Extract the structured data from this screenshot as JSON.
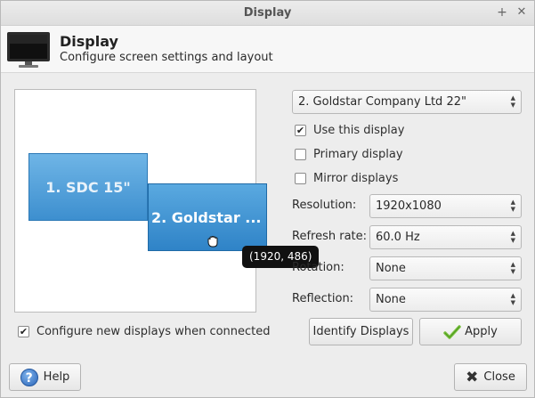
{
  "window": {
    "title": "Display"
  },
  "titlebar_buttons": {
    "pin": "+",
    "close": "✕"
  },
  "header": {
    "title": "Display",
    "subtitle": "Configure screen settings and layout"
  },
  "preview": {
    "monitors": [
      {
        "label": "1. SDC 15\""
      },
      {
        "label": "2. Goldstar ..."
      }
    ],
    "tooltip": "(1920, 486)"
  },
  "display_select": {
    "value": "2. Goldstar Company Ltd 22\""
  },
  "checks": {
    "use_display": {
      "label": "Use this display",
      "checked": true
    },
    "primary_display": {
      "label": "Primary display",
      "checked": false
    },
    "mirror_displays": {
      "label": "Mirror displays",
      "checked": false
    },
    "configure_new": {
      "label": "Configure new displays when connected",
      "checked": true
    }
  },
  "settings": {
    "resolution": {
      "label": "Resolution:",
      "value": "1920x1080"
    },
    "refresh_rate": {
      "label": "Refresh rate:",
      "value": "60.0 Hz"
    },
    "rotation": {
      "label": "Rotation:",
      "value": "None"
    },
    "reflection": {
      "label": "Reflection:",
      "value": "None"
    }
  },
  "buttons": {
    "identify": "Identify Displays",
    "apply": "Apply",
    "help": "Help",
    "close": "Close"
  }
}
